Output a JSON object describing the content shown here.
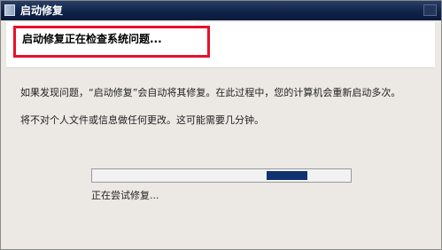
{
  "window": {
    "title": "启动修复"
  },
  "header": {
    "title": "启动修复正在检查系统问题..."
  },
  "content": {
    "paragraph1": "如果发现问题，“启动修复”会自动将其修复。在此过程中，您的计算机会重新启动多次。",
    "paragraph2": "将不对个人文件或信息做任何更改。这可能需要几分钟。"
  },
  "progress": {
    "mode": "indeterminate",
    "status_text": "正在尝试修复..."
  },
  "colors": {
    "titlebar": "#0e2147",
    "highlight_box": "#e8102a",
    "progress_fill": "#10336f"
  },
  "icons": {
    "title": "startup-repair-icon",
    "close": "close-icon"
  }
}
